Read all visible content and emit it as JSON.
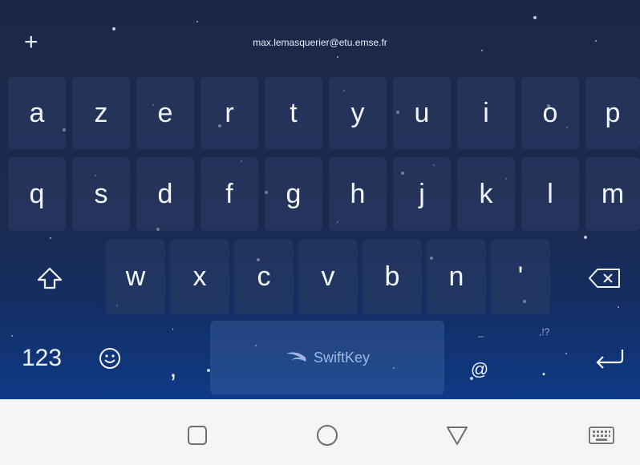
{
  "keyboard": {
    "email": "max.lemasquerier@etu.emse.fr",
    "row1": [
      "a",
      "z",
      "e",
      "r",
      "t",
      "y",
      "u",
      "i",
      "o",
      "p"
    ],
    "row2": [
      "q",
      "s",
      "d",
      "f",
      "g",
      "h",
      "j",
      "k",
      "l",
      "m"
    ],
    "row3": [
      "w",
      "x",
      "c",
      "v",
      "b",
      "n",
      "'"
    ],
    "row4": {
      "numbers_label": "123",
      "comma_label": ",",
      "comma_hint": "’",
      "space_label": "SwiftKey",
      "at_label": "@",
      "at_hint": "_",
      "period_label": ".",
      "period_hint": ",!?"
    },
    "icons": {
      "add": "plus-icon",
      "shift": "shift-icon",
      "backspace": "backspace-icon",
      "emoji": "emoji-icon",
      "enter": "enter-icon"
    }
  },
  "navbar": {
    "recents": "square-icon",
    "home": "circle-icon",
    "back": "triangle-icon",
    "keyboard": "keyboard-icon"
  },
  "colors": {
    "keyboard_top": "#1b2748",
    "keyboard_bottom": "#0f3a86",
    "key_text": "#f2f5ff",
    "navbar_bg": "#f5f5f5",
    "navbar_icon": "#6f6f6f"
  }
}
